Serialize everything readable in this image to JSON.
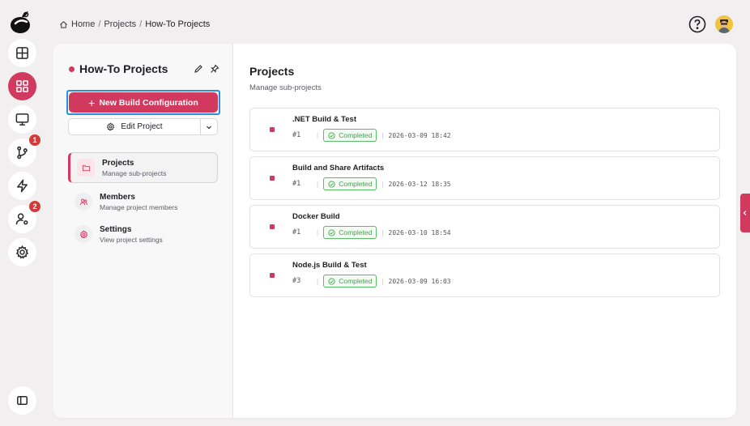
{
  "breadcrumb": {
    "home": "Home",
    "projects": "Projects",
    "current": "How-To Projects",
    "separator": "/"
  },
  "rail": {
    "badges": {
      "git": "1",
      "users": "2"
    }
  },
  "project": {
    "title": "How-To Projects",
    "new_build_label": "New Build Configuration",
    "edit_label": "Edit Project"
  },
  "nav": [
    {
      "title": "Projects",
      "subtitle": "Manage sub-projects"
    },
    {
      "title": "Members",
      "subtitle": "Manage project members"
    },
    {
      "title": "Settings",
      "subtitle": "View project settings"
    }
  ],
  "pane": {
    "title": "Projects",
    "subtitle": "Manage sub-projects"
  },
  "builds": [
    {
      "name": ".NET Build & Test",
      "number": "#1",
      "status": "Completed",
      "date": "2026-03-09 18:42"
    },
    {
      "name": "Build and Share Artifacts",
      "number": "#1",
      "status": "Completed",
      "date": "2026-03-12 18:35"
    },
    {
      "name": "Docker Build",
      "number": "#1",
      "status": "Completed",
      "date": "2026-03-10 18:54"
    },
    {
      "name": "Node.js Build & Test",
      "number": "#3",
      "status": "Completed",
      "date": "2026-03-09 16:03"
    }
  ],
  "colors": {
    "accent": "#d2395e",
    "success": "#43a34b",
    "focus": "#2b8fe0"
  }
}
